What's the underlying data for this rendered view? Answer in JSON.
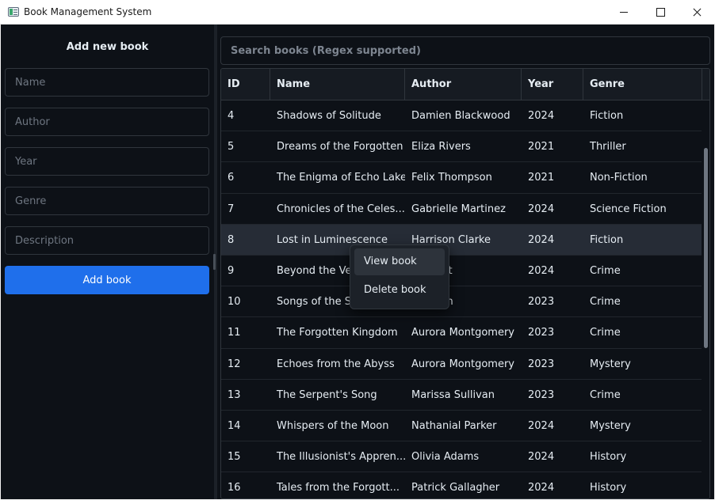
{
  "window": {
    "title": "Book Management System"
  },
  "form": {
    "heading": "Add new book",
    "name_placeholder": "Name",
    "author_placeholder": "Author",
    "year_placeholder": "Year",
    "genre_placeholder": "Genre",
    "description_placeholder": "Description",
    "submit_label": "Add book"
  },
  "search": {
    "placeholder": "Search books (Regex supported)"
  },
  "table": {
    "columns": [
      "ID",
      "Name",
      "Author",
      "Year",
      "Genre"
    ],
    "selected_id": "8",
    "rows": [
      {
        "id": "4",
        "name": "Shadows of Solitude",
        "author": "Damien Blackwood",
        "year": "2024",
        "genre": "Fiction"
      },
      {
        "id": "5",
        "name": "Dreams of the Forgotten",
        "author": "Eliza Rivers",
        "year": "2021",
        "genre": "Thriller"
      },
      {
        "id": "6",
        "name": "The Enigma of Echo Lake",
        "author": "Felix Thompson",
        "year": "2021",
        "genre": "Non-Fiction"
      },
      {
        "id": "7",
        "name": "Chronicles of the Celes...",
        "author": "Gabrielle Martinez",
        "year": "2024",
        "genre": "Science Fiction"
      },
      {
        "id": "8",
        "name": "Lost in Luminescence",
        "author": "Harrison Clarke",
        "year": "2024",
        "genre": "Fiction"
      },
      {
        "id": "9",
        "name": "Beyond the Veil",
        "author": "Bennett",
        "year": "2024",
        "genre": "Crime"
      },
      {
        "id": "10",
        "name": "Songs of the Si",
        "author": "nderson",
        "year": "2023",
        "genre": "Crime"
      },
      {
        "id": "11",
        "name": "The Forgotten Kingdom",
        "author": "Aurora Montgomery",
        "year": "2023",
        "genre": "Crime"
      },
      {
        "id": "12",
        "name": "Echoes from the Abyss",
        "author": "Aurora Montgomery",
        "year": "2023",
        "genre": "Mystery"
      },
      {
        "id": "13",
        "name": "The Serpent's Song",
        "author": "Marissa Sullivan",
        "year": "2023",
        "genre": "Crime"
      },
      {
        "id": "14",
        "name": "Whispers of the Moon",
        "author": "Nathanial Parker",
        "year": "2024",
        "genre": "Mystery"
      },
      {
        "id": "15",
        "name": "The Illusionist's Appren...",
        "author": "Olivia Adams",
        "year": "2024",
        "genre": "History"
      },
      {
        "id": "16",
        "name": "Tales from the Forgott...",
        "author": "Patrick Gallagher",
        "year": "2024",
        "genre": "History"
      }
    ]
  },
  "context_menu": {
    "items": [
      "View book",
      "Delete book"
    ],
    "hovered": "View book"
  }
}
